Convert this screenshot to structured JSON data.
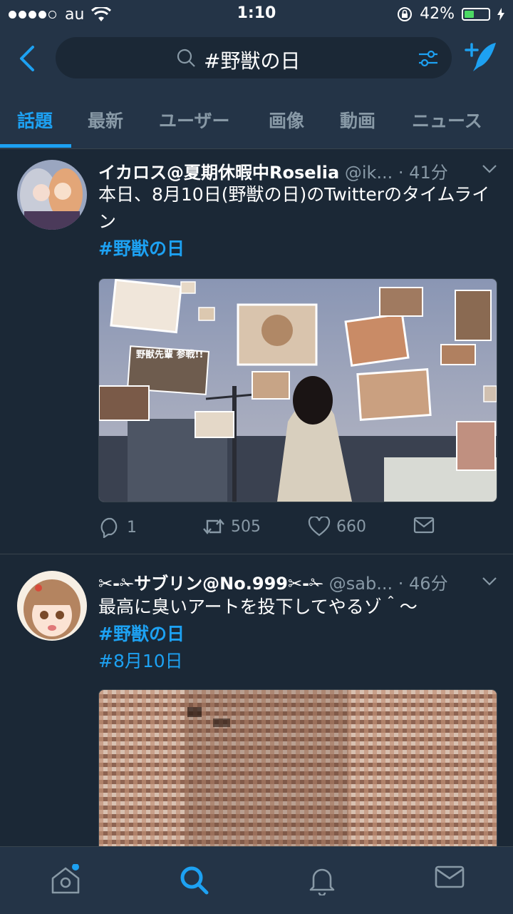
{
  "status_bar": {
    "carrier": "au",
    "time": "1:10",
    "battery_percent": "42%",
    "battery_level": 0.42
  },
  "search": {
    "query": "#野獣の日"
  },
  "tabs": [
    {
      "label": "話題",
      "active": true
    },
    {
      "label": "最新"
    },
    {
      "label": "ユーザー"
    },
    {
      "label": "画像"
    },
    {
      "label": "動画"
    },
    {
      "label": "ニュース"
    }
  ],
  "tweets": [
    {
      "name": "イカロス@夏期休暇中Roselia",
      "handle": "@ik...",
      "time": "· 41分",
      "text": "本日、8月10日(野獣の日)のTwitterのタイムライン",
      "hashtags": [
        "#野獣の日"
      ],
      "media_caption": "野獣先輩 参戦!!",
      "replies": "1",
      "retweets": "505",
      "likes": "660"
    },
    {
      "name": "✂-✁サブリン@No.999✂-✁",
      "handle": "@sab...",
      "time": "· 46分",
      "text": "最高に臭いアートを投下してやるゾ＾～",
      "hashtags": [
        "#野獣の日",
        "#8月10日"
      ]
    }
  ],
  "colors": {
    "background": "#1b2836",
    "bar": "#243447",
    "accent": "#1da1f2",
    "muted": "#8899a6",
    "divider": "#38444d"
  },
  "bottom_nav": [
    "home-icon",
    "search-icon",
    "bell-icon",
    "mail-icon"
  ]
}
